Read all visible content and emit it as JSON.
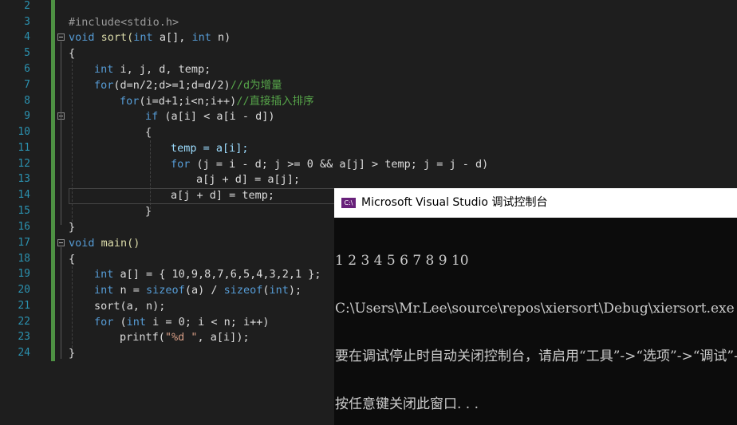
{
  "line_numbers": [
    "2",
    "3",
    "4",
    "5",
    "6",
    "7",
    "8",
    "9",
    "10",
    "11",
    "12",
    "13",
    "14",
    "15",
    "16",
    "17",
    "18",
    "19",
    "20",
    "21",
    "22",
    "23",
    "24"
  ],
  "code": {
    "l3": {
      "a": "#include",
      "b": "<stdio.h>"
    },
    "l4": {
      "a": "void",
      "b": " sort(",
      "c": "int",
      "d": " a[], ",
      "e": "int",
      "f": " n)"
    },
    "l5": {
      "a": "{"
    },
    "l6": {
      "a": "int",
      "b": " i, j, d, temp;"
    },
    "l7": {
      "a": "for",
      "b": "(d=n/2;d>=1;d=d/2)",
      "c": "//d为增量"
    },
    "l8": {
      "a": "for",
      "b": "(i=d+1;i<n;i++)",
      "c": "//直接插入排序"
    },
    "l9": {
      "a": "if",
      "b": " (a[i] < a[i - d])"
    },
    "l10": {
      "a": "{"
    },
    "l11": {
      "a": "temp = a[i];"
    },
    "l12": {
      "a": "for",
      "b": " (j = i - d; j >= 0 && a[j] > temp; j = j - d)"
    },
    "l13": {
      "a": "a[j + d] = a[j];"
    },
    "l14": {
      "a": "a[j + d] = temp;"
    },
    "l15": {
      "a": "}"
    },
    "l16": {
      "a": "}"
    },
    "l17": {
      "a": "void",
      "b": " main()"
    },
    "l18": {
      "a": "{"
    },
    "l19": {
      "a": "int",
      "b": " a[] = { 10,9,8,7,6,5,4,3,2,1 };"
    },
    "l20": {
      "a": "int",
      "b": " n = ",
      "c": "sizeof",
      "d": "(a) / ",
      "e": "sizeof",
      "f": "(",
      "g": "int",
      "h": ");"
    },
    "l21": {
      "a": "sort(a, n);"
    },
    "l22": {
      "a": "for",
      "b": " (",
      "c": "int",
      "d": " i = 0; i < n; i++)"
    },
    "l23": {
      "a": "printf(",
      "b": "\"%d \"",
      "c": ", a[i]);"
    },
    "l24": {
      "a": "}"
    }
  },
  "console": {
    "icon_text": "C:\\",
    "title": "Microsoft Visual Studio 调试控制台",
    "lines": [
      "1 2 3 4 5 6 7 8 9 10",
      "C:\\Users\\Mr.Lee\\source\\repos\\xiersort\\Debug\\xiersort.exe",
      "要在调试停止时自动关闭控制台，请启用“工具”->“选项”->“调试”->“调试停止时自动关闭控制台”。",
      "按任意键关闭此窗口. . ."
    ]
  },
  "colors": {
    "background": "#1e1e1e",
    "keyword": "#569cd6",
    "comment": "#57a64a",
    "line_number": "#2b91af",
    "console_bg": "#0c0c0c"
  }
}
